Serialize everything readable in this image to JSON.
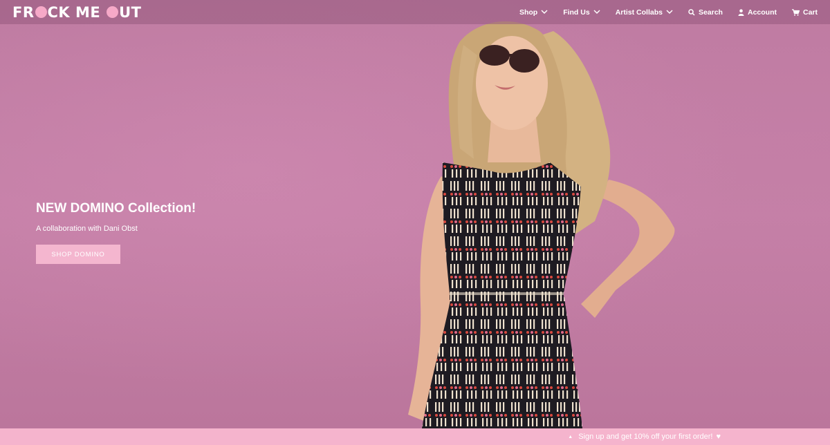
{
  "header": {
    "logo_text_1": "FR",
    "logo_text_2": "CK ME ",
    "logo_text_3": "UT",
    "nav": [
      {
        "label": "Shop",
        "icon": "chevron-down-icon"
      },
      {
        "label": "Find Us",
        "icon": "chevron-down-icon"
      },
      {
        "label": "Artist Collabs",
        "icon": "chevron-down-icon"
      },
      {
        "label": "Search",
        "icon": "search-icon"
      },
      {
        "label": "Account",
        "icon": "user-icon"
      },
      {
        "label": "Cart",
        "icon": "cart-icon"
      }
    ]
  },
  "hero": {
    "title": "NEW DOMINO Collection!",
    "subtitle": "A collaboration with Dani Obst",
    "button_label": "SHOP DOMINO"
  },
  "signup_bar": {
    "text": "Sign up and get 10% off your first order!",
    "icon": "heart-icon"
  },
  "colors": {
    "background": "#c07a9d",
    "accent": "#f4b6cf",
    "header": "#965a7d"
  }
}
